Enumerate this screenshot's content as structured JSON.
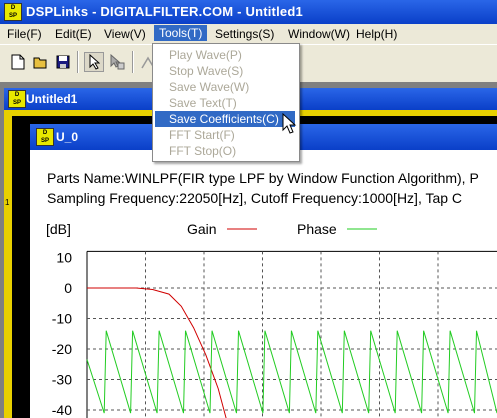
{
  "app": {
    "title": "DSPLinks - DIGITALFILTER.COM - Untitled1",
    "icon_top": "D",
    "icon_bottom": "SP"
  },
  "menu": [
    {
      "label": "File(F)"
    },
    {
      "label": "Edit(E)"
    },
    {
      "label": "View(V)"
    },
    {
      "label": "Tools(T)"
    },
    {
      "label": "Settings(S)"
    },
    {
      "label": "Window(W)"
    },
    {
      "label": "Help(H)"
    }
  ],
  "tools_menu": {
    "items": [
      {
        "label": "Play Wave(P)",
        "enabled": false
      },
      {
        "label": "Stop Wave(S)",
        "enabled": false
      },
      {
        "label": "Save Wave(W)",
        "enabled": false
      },
      {
        "label": "Save Text(T)",
        "enabled": false
      },
      {
        "label": "Save Coefficients(C)",
        "enabled": true,
        "highlighted": true
      },
      {
        "label": "FFT Start(F)",
        "enabled": false
      },
      {
        "label": "FFT Stop(O)",
        "enabled": false
      }
    ]
  },
  "toolbar": {
    "icons": [
      "new-icon",
      "open-icon",
      "save-icon",
      "pointer-icon",
      "move-icon",
      "wire-icon"
    ]
  },
  "doc_window": {
    "title": "Untitled1",
    "ruler_mark": "1"
  },
  "unit_window": {
    "title": "U_0",
    "parts_line": "Parts Name:WINLPF(FIR type LPF by Window Function Algorithm), P",
    "sampling_line": "Sampling Frequency:22050[Hz], Cutoff Frequency:1000[Hz], Tap C"
  },
  "chart_data": {
    "type": "line",
    "ylabel": "[dB]",
    "yticks": [
      "10",
      "0",
      "-10",
      "-20",
      "-30",
      "-40"
    ],
    "ylim": [
      -43,
      12
    ],
    "grid": true,
    "legend": [
      {
        "name": "Gain",
        "color": "#d00000"
      },
      {
        "name": "Phase",
        "color": "#22cc22"
      }
    ],
    "series": [
      {
        "name": "Gain",
        "color": "#d00000",
        "x": [
          0,
          0.12,
          0.16,
          0.2,
          0.23,
          0.26,
          0.29,
          0.32,
          0.34
        ],
        "y": [
          0,
          0,
          -0.5,
          -2,
          -6,
          -13,
          -22,
          -33,
          -43
        ]
      },
      {
        "name": "Phase",
        "color": "#22cc22",
        "pattern": "sawtooth",
        "periods": 15.5,
        "high": -14,
        "low": -41
      }
    ]
  }
}
